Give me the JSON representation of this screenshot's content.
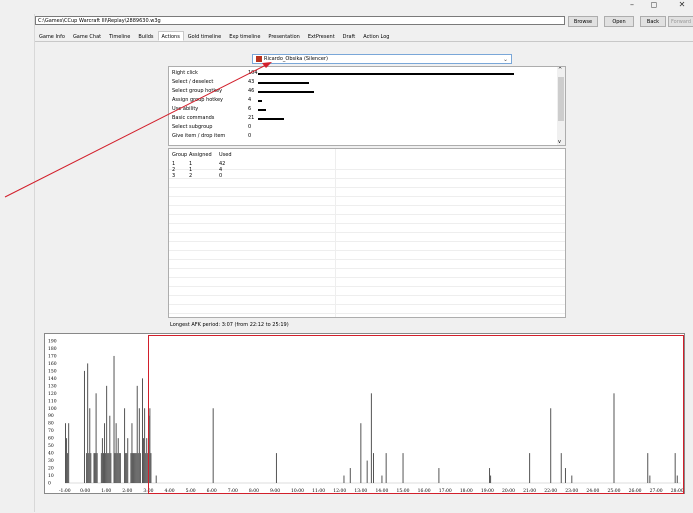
{
  "window": {
    "controls": {
      "minimize": "–",
      "maximize": "◻",
      "close": "✕"
    }
  },
  "toolbar": {
    "path": "C:\\Games\\CCup Warcraft III\\Replay\\2889630.w3g",
    "browse": "Browse",
    "open": "Open",
    "back": "Back",
    "forward": "Forward"
  },
  "tabs": [
    "Game Info",
    "Game Chat",
    "Timeline",
    "Builds",
    "Actions",
    "Gold timeline",
    "Exp timeline",
    "Presentation",
    "ExtPresent",
    "Draft",
    "Action Log"
  ],
  "active_tab": 4,
  "player": {
    "selected": "Ricardo_Obsika (Silencer)"
  },
  "actions": [
    {
      "label": "Right click",
      "value": "104",
      "ratio": 1.0
    },
    {
      "label": "Select / deselect",
      "value": "43",
      "ratio": 0.2
    },
    {
      "label": "Select group hotkey",
      "value": "46",
      "ratio": 0.22
    },
    {
      "label": "Assign group hotkey",
      "value": "4",
      "ratio": 0.015
    },
    {
      "label": "Use ability",
      "value": "6",
      "ratio": 0.03
    },
    {
      "label": "Basic commands",
      "value": "21",
      "ratio": 0.1
    },
    {
      "label": "Select subgroup",
      "value": "0",
      "ratio": 0
    },
    {
      "label": "Give item / drop item",
      "value": "0",
      "ratio": 0
    }
  ],
  "groups": {
    "headers": [
      "Group",
      "Assigned",
      "Used"
    ],
    "rows": [
      [
        "1",
        "1",
        "42"
      ],
      [
        "2",
        "1",
        "4"
      ],
      [
        "3",
        "2",
        "0"
      ]
    ]
  },
  "afk_text": "Longest AFK period: 3:07 (from 22:12 to 25:19)",
  "chart_data": {
    "type": "bar",
    "xlabel": "",
    "ylabel": "",
    "ylim": [
      0,
      190
    ],
    "y_ticks": [
      "0",
      "10",
      "20",
      "30",
      "40",
      "50",
      "60",
      "70",
      "80",
      "90",
      "100",
      "110",
      "120",
      "130",
      "140",
      "150",
      "160",
      "170",
      "180",
      "190"
    ],
    "x_ticks": [
      "-1:00",
      "0:00",
      "1:00",
      "2:00",
      "3:00",
      "4:00",
      "5:00",
      "6:00",
      "7:00",
      "8:00",
      "9:00",
      "10:00",
      "11:00",
      "12:00",
      "13:00",
      "14:00",
      "15:00",
      "16:00",
      "17:00",
      "18:00",
      "19:00",
      "20:00",
      "21:00",
      "22:00",
      "23:00",
      "24:00",
      "25:00",
      "26:00",
      "27:00",
      "28:00"
    ],
    "x_range_minutes": [
      -1,
      28.2
    ],
    "bars": [
      {
        "x": -1.0,
        "y": 80
      },
      {
        "x": -0.95,
        "y": 60
      },
      {
        "x": -0.9,
        "y": 40
      },
      {
        "x": -0.85,
        "y": 80
      },
      {
        "x": -0.1,
        "y": 150
      },
      {
        "x": 0.0,
        "y": 40
      },
      {
        "x": 0.05,
        "y": 160
      },
      {
        "x": 0.1,
        "y": 40
      },
      {
        "x": 0.15,
        "y": 100
      },
      {
        "x": 0.2,
        "y": 40
      },
      {
        "x": 0.35,
        "y": 40
      },
      {
        "x": 0.4,
        "y": 40
      },
      {
        "x": 0.45,
        "y": 120
      },
      {
        "x": 0.5,
        "y": 40
      },
      {
        "x": 0.7,
        "y": 40
      },
      {
        "x": 0.75,
        "y": 60
      },
      {
        "x": 0.8,
        "y": 40
      },
      {
        "x": 0.85,
        "y": 80
      },
      {
        "x": 0.9,
        "y": 40
      },
      {
        "x": 0.95,
        "y": 130
      },
      {
        "x": 1.0,
        "y": 40
      },
      {
        "x": 1.05,
        "y": 40
      },
      {
        "x": 1.1,
        "y": 90
      },
      {
        "x": 1.15,
        "y": 40
      },
      {
        "x": 1.3,
        "y": 170
      },
      {
        "x": 1.35,
        "y": 40
      },
      {
        "x": 1.4,
        "y": 80
      },
      {
        "x": 1.45,
        "y": 40
      },
      {
        "x": 1.5,
        "y": 60
      },
      {
        "x": 1.55,
        "y": 40
      },
      {
        "x": 1.6,
        "y": 40
      },
      {
        "x": 1.8,
        "y": 100
      },
      {
        "x": 1.85,
        "y": 40
      },
      {
        "x": 1.9,
        "y": 40
      },
      {
        "x": 1.95,
        "y": 60
      },
      {
        "x": 2.1,
        "y": 40
      },
      {
        "x": 2.15,
        "y": 80
      },
      {
        "x": 2.2,
        "y": 40
      },
      {
        "x": 2.25,
        "y": 40
      },
      {
        "x": 2.3,
        "y": 40
      },
      {
        "x": 2.35,
        "y": 40
      },
      {
        "x": 2.4,
        "y": 130
      },
      {
        "x": 2.45,
        "y": 40
      },
      {
        "x": 2.5,
        "y": 100
      },
      {
        "x": 2.55,
        "y": 40
      },
      {
        "x": 2.65,
        "y": 140
      },
      {
        "x": 2.7,
        "y": 60
      },
      {
        "x": 2.75,
        "y": 100
      },
      {
        "x": 2.8,
        "y": 40
      },
      {
        "x": 2.85,
        "y": 60
      },
      {
        "x": 2.9,
        "y": 40
      },
      {
        "x": 2.95,
        "y": 90
      },
      {
        "x": 3.0,
        "y": 100
      },
      {
        "x": 3.05,
        "y": 40
      },
      {
        "x": 3.3,
        "y": 10
      },
      {
        "x": 6.0,
        "y": 100
      },
      {
        "x": 9.0,
        "y": 40
      },
      {
        "x": 12.2,
        "y": 10
      },
      {
        "x": 12.5,
        "y": 20
      },
      {
        "x": 13.0,
        "y": 80
      },
      {
        "x": 13.3,
        "y": 30
      },
      {
        "x": 13.5,
        "y": 120
      },
      {
        "x": 13.6,
        "y": 40
      },
      {
        "x": 14.0,
        "y": 10
      },
      {
        "x": 14.2,
        "y": 40
      },
      {
        "x": 15.0,
        "y": 40
      },
      {
        "x": 16.7,
        "y": 20
      },
      {
        "x": 19.1,
        "y": 20
      },
      {
        "x": 19.15,
        "y": 10
      },
      {
        "x": 21.0,
        "y": 40
      },
      {
        "x": 22.0,
        "y": 100
      },
      {
        "x": 22.5,
        "y": 40
      },
      {
        "x": 22.7,
        "y": 20
      },
      {
        "x": 23.0,
        "y": 10
      },
      {
        "x": 25.0,
        "y": 120
      },
      {
        "x": 26.6,
        "y": 40
      },
      {
        "x": 26.7,
        "y": 10
      },
      {
        "x": 27.9,
        "y": 40
      },
      {
        "x": 28.0,
        "y": 10
      },
      {
        "x": 29.5,
        "y": 40
      },
      {
        "x": 30.0,
        "y": 100
      },
      {
        "x": 31.0,
        "y": 40
      },
      {
        "x": 32.1,
        "y": 40
      },
      {
        "x": 32.2,
        "y": 100
      }
    ]
  },
  "colors": {
    "annotation_red": "#d21f2b",
    "bar_color": "#555555"
  }
}
